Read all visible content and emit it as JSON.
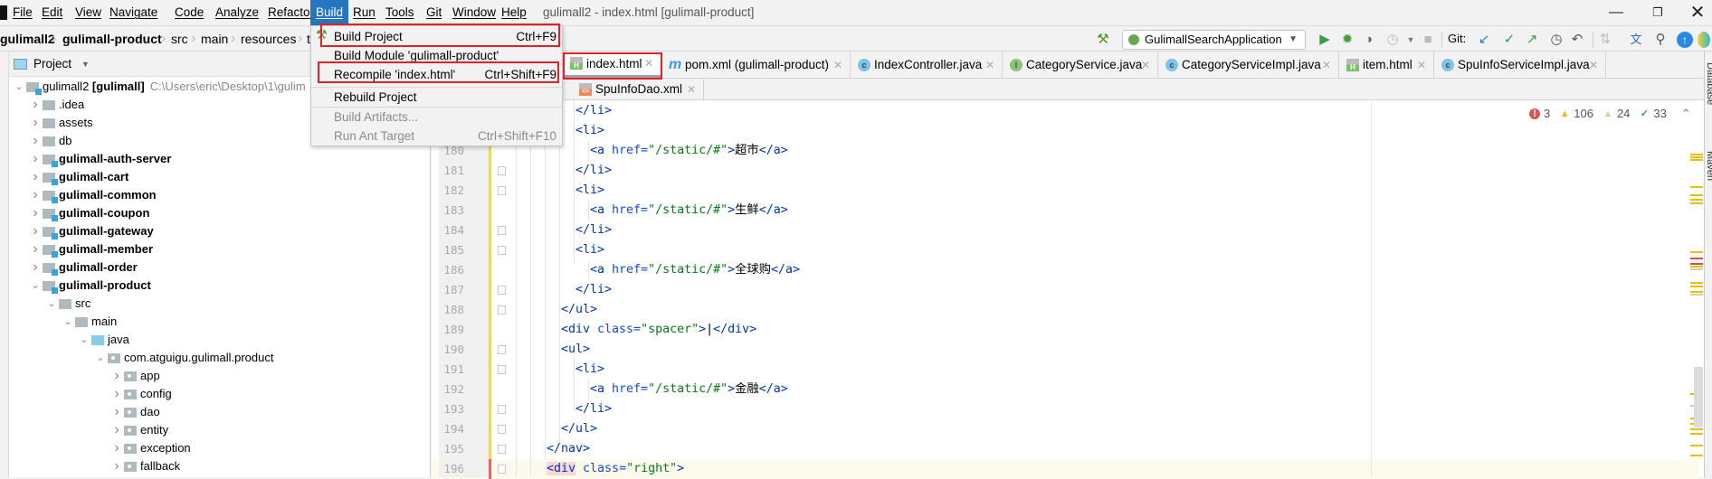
{
  "window": {
    "title": "gulimall2 - index.html [gulimall-product]",
    "controls": [
      "minimize-icon",
      "restore-icon",
      "close-icon"
    ]
  },
  "menubar": {
    "items": [
      "File",
      "Edit",
      "View",
      "Navigate",
      "Code",
      "Analyze",
      "Refactor",
      "Build",
      "Run",
      "Tools",
      "Git",
      "Window",
      "Help"
    ],
    "active": "Build"
  },
  "build_menu": {
    "items": [
      {
        "label": "Build Project",
        "shortcut": "Ctrl+F9",
        "enabled": true,
        "highlighted_box": true
      },
      {
        "label": "Build Module 'gulimall-product'",
        "shortcut": "",
        "enabled": true
      },
      {
        "label": "Recompile 'index.html'",
        "shortcut": "Ctrl+Shift+F9",
        "enabled": true,
        "highlighted_box": true
      },
      {
        "label": "Rebuild Project",
        "shortcut": "",
        "enabled": true
      },
      {
        "label": "Build Artifacts...",
        "shortcut": "",
        "enabled": false
      },
      {
        "label": "Run Ant Target",
        "shortcut": "Ctrl+Shift+F10",
        "enabled": false
      }
    ]
  },
  "breadcrumb": [
    "gulimall2",
    "gulimall-product",
    "src",
    "main",
    "resources",
    "t"
  ],
  "toolbar": {
    "run_config": "GulimallSearchApplication",
    "git_label": "Git:",
    "icons": [
      "hammer-icon",
      "run-icon",
      "debug-icon",
      "coverage-icon",
      "profile-icon",
      "stop-icon",
      "git-update-icon",
      "git-commit-icon",
      "git-push-icon",
      "history-icon",
      "rollback-icon",
      "translate-icon",
      "search-icon",
      "update-icon"
    ]
  },
  "project_panel": {
    "title": "Project",
    "tree": [
      {
        "label": "gulimall2 [gulimall]",
        "bold_part": "[gulimall]",
        "prefix": "gulimall2 ",
        "path": "C:\\Users\\eric\\Desktop\\1\\gulim",
        "depth": 0,
        "expanded": true,
        "icon": "module"
      },
      {
        "label": ".idea",
        "depth": 1,
        "expanded": false,
        "icon": "folder"
      },
      {
        "label": "assets",
        "depth": 1,
        "expanded": false,
        "icon": "folder"
      },
      {
        "label": "db",
        "depth": 1,
        "expanded": false,
        "icon": "folder"
      },
      {
        "label": "gulimall-auth-server",
        "depth": 1,
        "expanded": false,
        "icon": "module",
        "bold": true
      },
      {
        "label": "gulimall-cart",
        "depth": 1,
        "expanded": false,
        "icon": "module",
        "bold": true
      },
      {
        "label": "gulimall-common",
        "depth": 1,
        "expanded": false,
        "icon": "module",
        "bold": true
      },
      {
        "label": "gulimall-coupon",
        "depth": 1,
        "expanded": false,
        "icon": "module",
        "bold": true
      },
      {
        "label": "gulimall-gateway",
        "depth": 1,
        "expanded": false,
        "icon": "module",
        "bold": true
      },
      {
        "label": "gulimall-member",
        "depth": 1,
        "expanded": false,
        "icon": "module",
        "bold": true
      },
      {
        "label": "gulimall-order",
        "depth": 1,
        "expanded": false,
        "icon": "module",
        "bold": true
      },
      {
        "label": "gulimall-product",
        "depth": 1,
        "expanded": true,
        "icon": "module",
        "bold": true
      },
      {
        "label": "src",
        "depth": 2,
        "expanded": true,
        "icon": "folder"
      },
      {
        "label": "main",
        "depth": 3,
        "expanded": true,
        "icon": "folder"
      },
      {
        "label": "java",
        "depth": 4,
        "expanded": true,
        "icon": "java"
      },
      {
        "label": "com.atguigu.gulimall.product",
        "depth": 5,
        "expanded": true,
        "icon": "package"
      },
      {
        "label": "app",
        "depth": 6,
        "expanded": false,
        "icon": "package"
      },
      {
        "label": "config",
        "depth": 6,
        "expanded": false,
        "icon": "package"
      },
      {
        "label": "dao",
        "depth": 6,
        "expanded": false,
        "icon": "package"
      },
      {
        "label": "entity",
        "depth": 6,
        "expanded": false,
        "icon": "package"
      },
      {
        "label": "exception",
        "depth": 6,
        "expanded": false,
        "icon": "package"
      },
      {
        "label": "fallback",
        "depth": 6,
        "expanded": false,
        "icon": "package"
      }
    ]
  },
  "tabs_row1": [
    {
      "label": "index.html",
      "icon": "html",
      "active": true
    },
    {
      "label": "pom.xml (gulimall-product)",
      "icon": "maven"
    },
    {
      "label": "IndexController.java",
      "icon": "class"
    },
    {
      "label": "CategoryService.java",
      "icon": "interface"
    },
    {
      "label": "CategoryServiceImpl.java",
      "icon": "class"
    },
    {
      "label": "item.html",
      "icon": "html"
    },
    {
      "label": "SpuInfoServiceImpl.java",
      "icon": "class"
    }
  ],
  "tabs_row2": [
    {
      "label": "SpuInfoDao.xml",
      "icon": "xml"
    }
  ],
  "inspections": {
    "errors": "3",
    "warnings": "106",
    "weak_warnings": "24",
    "typos": "33"
  },
  "right_tool_windows": [
    "Database",
    "Maven"
  ],
  "editor": {
    "current_line": 196,
    "lines": [
      {
        "n": 178,
        "indent": 2,
        "tokens": [
          [
            "tag",
            "</li>"
          ]
        ]
      },
      {
        "n": 179,
        "indent": 2,
        "tokens": [
          [
            "tag",
            "<li>"
          ]
        ]
      },
      {
        "n": 180,
        "indent": 3,
        "tokens": [
          [
            "tag",
            "<a "
          ],
          [
            "attr",
            "href="
          ],
          [
            "val",
            "\"/static/#\""
          ],
          [
            "tag",
            ">"
          ],
          [
            "text",
            "超市"
          ],
          [
            "tag",
            "</a>"
          ]
        ]
      },
      {
        "n": 181,
        "indent": 2,
        "tokens": [
          [
            "tag",
            "</li>"
          ]
        ]
      },
      {
        "n": 182,
        "indent": 2,
        "tokens": [
          [
            "tag",
            "<li>"
          ]
        ]
      },
      {
        "n": 183,
        "indent": 3,
        "tokens": [
          [
            "tag",
            "<a "
          ],
          [
            "attr",
            "href="
          ],
          [
            "val",
            "\"/static/#\""
          ],
          [
            "tag",
            ">"
          ],
          [
            "text",
            "生鲜"
          ],
          [
            "tag",
            "</a>"
          ]
        ]
      },
      {
        "n": 184,
        "indent": 2,
        "tokens": [
          [
            "tag",
            "</li>"
          ]
        ]
      },
      {
        "n": 185,
        "indent": 2,
        "tokens": [
          [
            "tag",
            "<li>"
          ]
        ]
      },
      {
        "n": 186,
        "indent": 3,
        "tokens": [
          [
            "tag",
            "<a "
          ],
          [
            "attr",
            "href="
          ],
          [
            "val",
            "\"/static/#\""
          ],
          [
            "tag",
            ">"
          ],
          [
            "text",
            "全球购"
          ],
          [
            "tag",
            "</a>"
          ]
        ]
      },
      {
        "n": 187,
        "indent": 2,
        "tokens": [
          [
            "tag",
            "</li>"
          ]
        ]
      },
      {
        "n": 188,
        "indent": 1,
        "tokens": [
          [
            "tag",
            "</ul>"
          ]
        ]
      },
      {
        "n": 189,
        "indent": 1,
        "tokens": [
          [
            "tag",
            "<div "
          ],
          [
            "attr",
            "class="
          ],
          [
            "val",
            "\"spacer\""
          ],
          [
            "tag",
            ">"
          ],
          [
            "text",
            "|"
          ],
          [
            "tag",
            "</div>"
          ]
        ]
      },
      {
        "n": 190,
        "indent": 1,
        "tokens": [
          [
            "tag",
            "<ul>"
          ]
        ]
      },
      {
        "n": 191,
        "indent": 2,
        "tokens": [
          [
            "tag",
            "<li>"
          ]
        ]
      },
      {
        "n": 192,
        "indent": 3,
        "tokens": [
          [
            "tag",
            "<a "
          ],
          [
            "attr",
            "href="
          ],
          [
            "val",
            "\"/static/#\""
          ],
          [
            "tag",
            ">"
          ],
          [
            "text",
            "金融"
          ],
          [
            "tag",
            "</a>"
          ]
        ]
      },
      {
        "n": 193,
        "indent": 2,
        "tokens": [
          [
            "tag",
            "</li>"
          ]
        ]
      },
      {
        "n": 194,
        "indent": 1,
        "tokens": [
          [
            "tag",
            "</ul>"
          ]
        ]
      },
      {
        "n": 195,
        "indent": 0,
        "tokens": [
          [
            "tag",
            "</nav>"
          ]
        ]
      },
      {
        "n": 196,
        "indent": 0,
        "tokens": [
          [
            "match",
            "<div"
          ],
          [
            "attr",
            " class="
          ],
          [
            "val",
            "\"right\""
          ],
          [
            "tag",
            ">"
          ]
        ]
      }
    ]
  },
  "colors": {
    "accent": "#2675bf",
    "highlight_box": "#e3202a",
    "tag": "#0033b3",
    "attr_value": "#067d17"
  }
}
